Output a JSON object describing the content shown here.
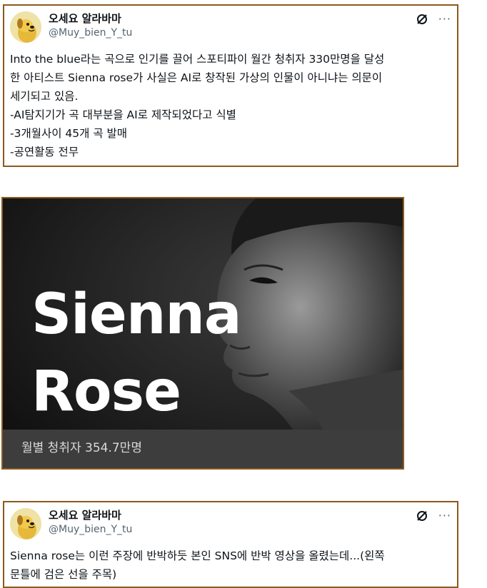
{
  "tweets": [
    {
      "user": {
        "display_name": "오세요 알라바마",
        "handle": "@Muy_bien_Y_tu",
        "avatar_icon": "yellow-dog-avatar-icon"
      },
      "actions": {
        "grok_icon": "slashed-circle-icon",
        "more_label": "···"
      },
      "lines": [
        "Into the blue라는 곡으로 인기를 끌어 스포티파이 월간 청취자 330만명을 달성",
        "한 아티스트 Sienna rose가 사실은 AI로 창작된 가상의 인물이 아니냐는 의문이",
        "세기되고 있음.",
        "-AI탐지기가 곡 대부분을 AI로 제작되었다고 식별",
        "-3개월사이 45개 곡 발매",
        "-공연활동 전무"
      ]
    },
    {
      "user": {
        "display_name": "오세요 알라바마",
        "handle": "@Muy_bien_Y_tu",
        "avatar_icon": "yellow-dog-avatar-icon"
      },
      "actions": {
        "grok_icon": "slashed-circle-icon",
        "more_label": "···"
      },
      "lines": [
        "Sienna rose는 이런 주장에 반박하듯 본인 SNS에 반박 영상을 올렸는데...(왼쪽",
        "문틀에 검은 선을 주목)"
      ]
    }
  ],
  "media": {
    "title_line1": "Sienna",
    "title_line2": "Rose",
    "caption": "월별 청취자 354.7만명"
  },
  "colors": {
    "card_border": "#8b5a1e",
    "handle_gray": "#536471",
    "media_footer": "#3d3d3d"
  }
}
